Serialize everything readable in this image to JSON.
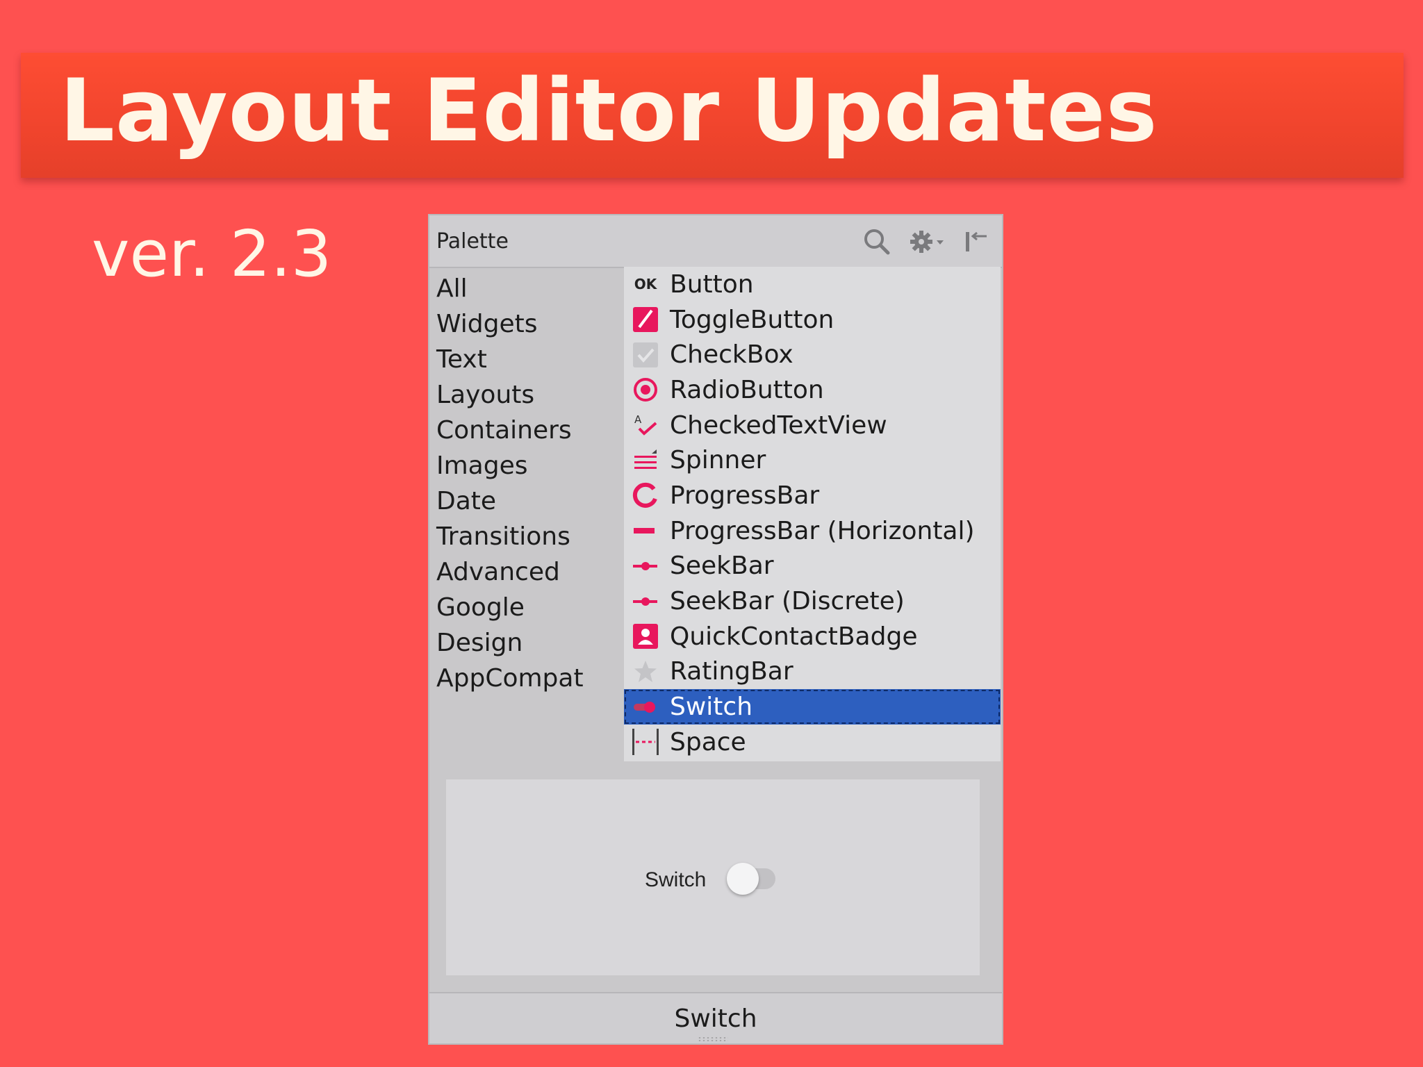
{
  "slide": {
    "title": "Layout Editor Updates",
    "subtitle": "ver. 2.3"
  },
  "palette": {
    "title": "Palette",
    "header_icons": [
      "search-icon",
      "gear-icon",
      "collapse-panel-icon"
    ],
    "categories": [
      "All",
      "Widgets",
      "Text",
      "Layouts",
      "Containers",
      "Images",
      "Date",
      "Transitions",
      "Advanced",
      "Google",
      "Design",
      "AppCompat"
    ],
    "widgets": [
      {
        "label": "Button",
        "icon": "ok-icon"
      },
      {
        "label": "ToggleButton",
        "icon": "toggle-icon"
      },
      {
        "label": "CheckBox",
        "icon": "checkbox-icon"
      },
      {
        "label": "RadioButton",
        "icon": "radio-icon"
      },
      {
        "label": "CheckedTextView",
        "icon": "checked-text-icon"
      },
      {
        "label": "Spinner",
        "icon": "spinner-icon"
      },
      {
        "label": "ProgressBar",
        "icon": "progress-circle-icon"
      },
      {
        "label": "ProgressBar (Horizontal)",
        "icon": "progress-horizontal-icon"
      },
      {
        "label": "SeekBar",
        "icon": "seekbar-icon"
      },
      {
        "label": "SeekBar (Discrete)",
        "icon": "seekbar-discrete-icon"
      },
      {
        "label": "QuickContactBadge",
        "icon": "contact-badge-icon"
      },
      {
        "label": "RatingBar",
        "icon": "star-icon"
      },
      {
        "label": "Switch",
        "icon": "switch-icon",
        "selected": true
      },
      {
        "label": "Space",
        "icon": "space-icon"
      }
    ],
    "ok_icon_text": "OK",
    "preview": {
      "label": "Switch",
      "switch_on": false
    },
    "footer_label": "Switch"
  },
  "colors": {
    "background": "#fe5150",
    "banner": "#ee432c",
    "accent_pink": "#e8175d",
    "selection": "#2d5fbf"
  }
}
